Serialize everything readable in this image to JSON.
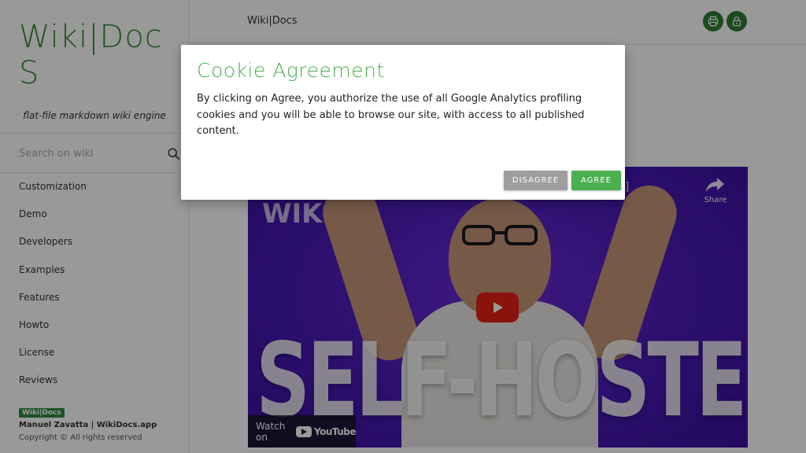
{
  "sidebar": {
    "brand": "Wiki|DocS",
    "tagline": "flat-file markdown wiki engine",
    "search_placeholder": "Search on wiki",
    "items": [
      {
        "label": "Customization"
      },
      {
        "label": "Demo"
      },
      {
        "label": "Developers"
      },
      {
        "label": "Examples"
      },
      {
        "label": "Features"
      },
      {
        "label": "Howto"
      },
      {
        "label": "License"
      },
      {
        "label": "Reviews"
      }
    ],
    "footer": {
      "badge": "Wiki|Docs",
      "author": "Manuel Zavatta | WikiDocs.app",
      "copyright": "Copyright © All rights reserved"
    }
  },
  "header": {
    "title": "Wiki|Docs",
    "print_icon": "print-icon",
    "lock_icon": "lock-icon"
  },
  "video": {
    "big_text": "SELF-HOSTED",
    "top_text": "WIKI",
    "title_fragment": "n]",
    "share_label": "Share",
    "watch_on_label": "Watch on",
    "youtube_label": "YouTube",
    "play_icon": "play-icon"
  },
  "modal": {
    "title": "Cookie Agreement",
    "body": "By clicking on Agree, you authorize the use of all Google Analytics profiling cookies and you will be able to browse our site, with access to all published content.",
    "disagree_label": "DISAGREE",
    "agree_label": "AGREE"
  },
  "colors": {
    "brand_green": "#3a8a3a",
    "accent_green": "#4caf50",
    "header_button_green": "#2e7d32",
    "disagree_gray": "#9e9e9e",
    "video_purple": "#4a1ab8",
    "youtube_red": "#e62117"
  }
}
